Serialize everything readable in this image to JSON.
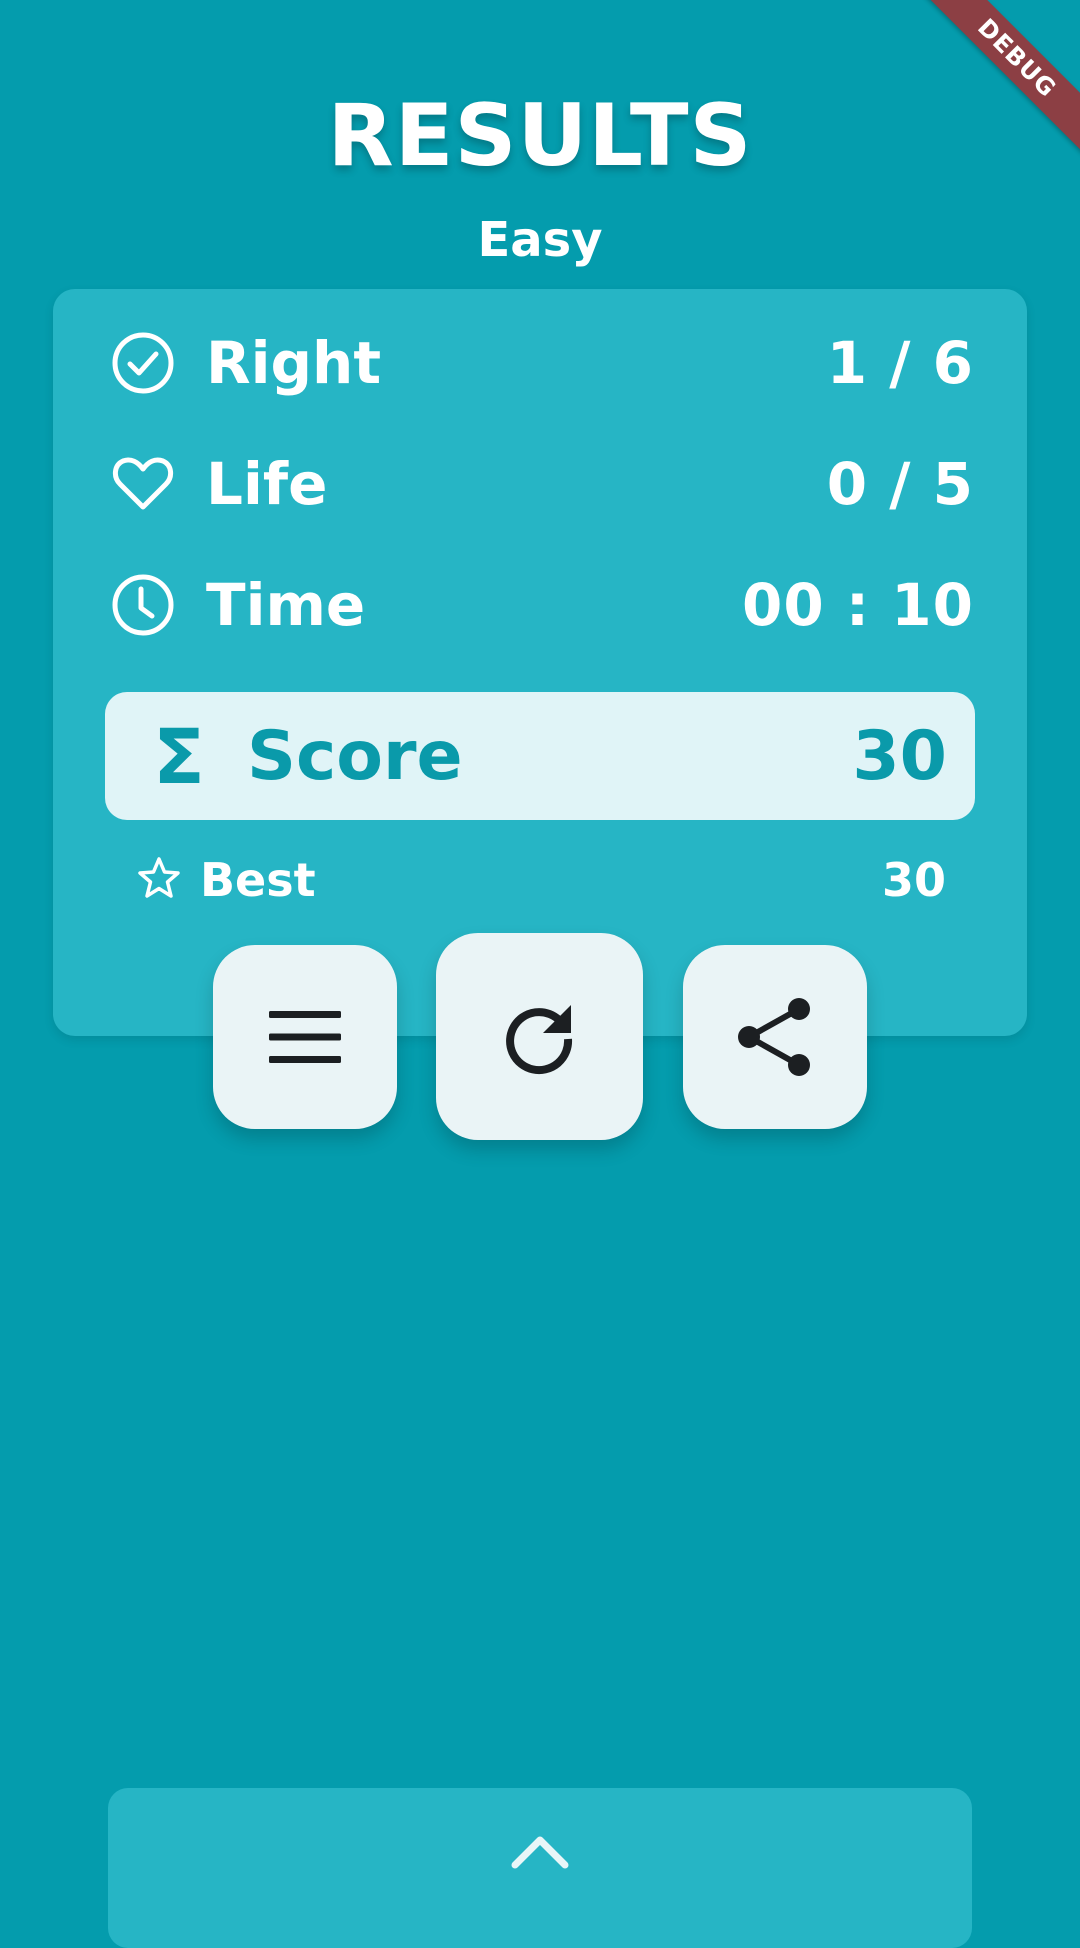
{
  "debug_banner": "DEBUG",
  "title": "RESULTS",
  "difficulty": "Easy",
  "stats": {
    "right": {
      "icon": "check-circle-icon",
      "label": "Right",
      "value": "1 / 6"
    },
    "life": {
      "icon": "heart-icon",
      "label": "Life",
      "value": "0 / 5"
    },
    "time": {
      "icon": "clock-icon",
      "label": "Time",
      "value": "00 : 10"
    }
  },
  "score": {
    "icon": "sigma-icon",
    "symbol": "Σ",
    "label": "Score",
    "value": "30"
  },
  "best": {
    "icon": "star-icon",
    "label": "Best",
    "value": "30"
  },
  "actions": [
    "menu-icon",
    "restart-icon",
    "share-icon"
  ],
  "bottom_panel": {
    "icon": "chevron-up-icon"
  },
  "colors": {
    "background": "#049cad",
    "card": "#26b5c5",
    "score_bg": "#e0f4f7",
    "score_text": "#0a9aaa",
    "button_bg": "#eaf4f6",
    "debug": "#8c3f44"
  }
}
